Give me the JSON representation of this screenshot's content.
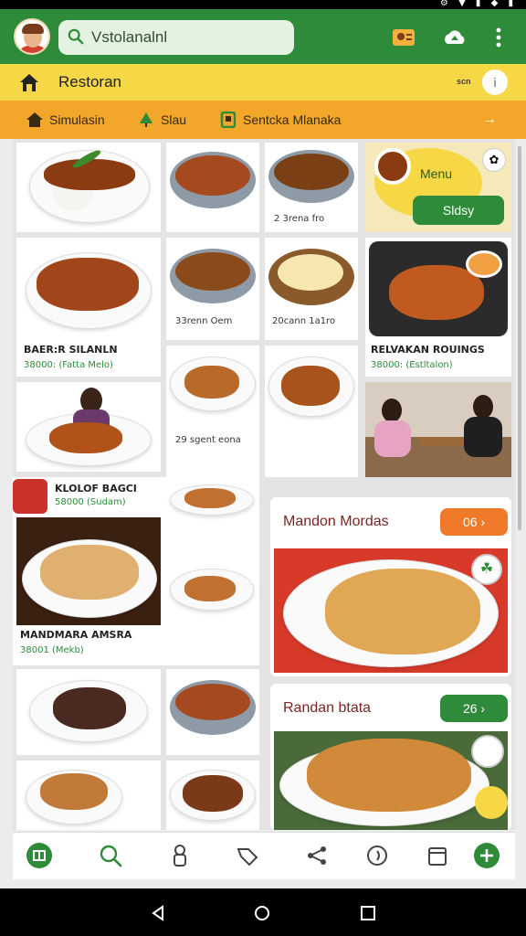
{
  "search": {
    "value": "Vstolanalnl"
  },
  "location": {
    "title": "Restoran",
    "tag": "scn",
    "info_icon": "i"
  },
  "subnav": {
    "items": [
      {
        "label": "Simulasin",
        "icon": "home-icon"
      },
      {
        "label": "Slau",
        "icon": "tree-icon"
      },
      {
        "label": "Sentcka Mlanaka",
        "icon": "bookmark-icon"
      }
    ],
    "arrow": "→"
  },
  "menu_card": {
    "title": "Menu",
    "button": "Sldsy"
  },
  "cards": {
    "c1": {},
    "c2": {},
    "c3": {
      "label": "2 3rena fro"
    },
    "c4": {
      "label": "33renn Oem"
    },
    "c5": {
      "label": "20cann 1a1ro"
    },
    "c6": {
      "label": "29 sgent eona"
    },
    "item_beer": {
      "name": "BAER:R SILANLN",
      "price": "38000: (Fatta Melo)"
    },
    "item_relv": {
      "name": "RELVAKAN ROUINGS",
      "price": "38000: (Estltalon)"
    },
    "item_kolof": {
      "name": "KLOLOF BAGCI",
      "price": "58000 (Sudam)"
    },
    "item_mand": {
      "name": "MANDMARA AMSRA",
      "price": "38001 (Mekb)"
    }
  },
  "promos": [
    {
      "title": "Mandon Mordas",
      "button": "06 ›",
      "color": "#f07a2a"
    },
    {
      "title": "Randan btata",
      "button": "26 ›",
      "color": "#2e8b3a"
    }
  ],
  "bottom_nav": [
    "store-icon",
    "search-icon",
    "chef-icon",
    "tag-icon",
    "share-icon",
    "leaf-icon",
    "calendar-icon",
    "add-icon"
  ],
  "colors": {
    "primary_green": "#2e8b3a",
    "yellow": "#f6d745",
    "orange": "#f2a62a"
  }
}
